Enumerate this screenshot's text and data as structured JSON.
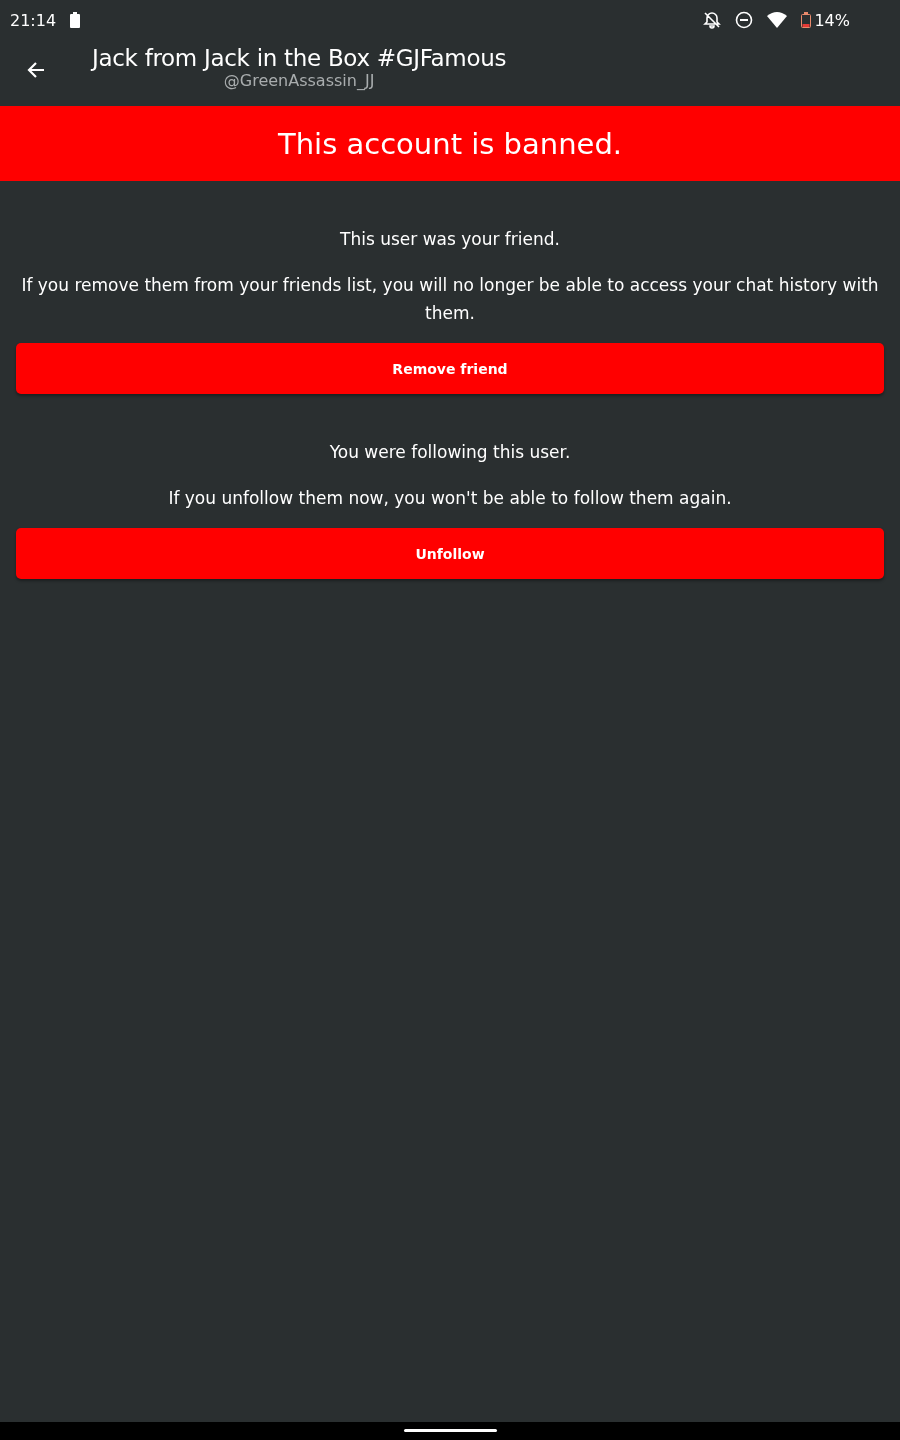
{
  "status_bar": {
    "time": "21:14",
    "battery": "14%"
  },
  "header": {
    "title": "Jack from Jack in the Box #GJFamous",
    "handle": "@GreenAssassin_JJ"
  },
  "banner": "This account is banned.",
  "sections": [
    {
      "heading": "This user was your friend.",
      "body": "If you remove them from your friends list, you will no longer be able to access your chat history with them.",
      "button": "Remove friend"
    },
    {
      "heading": "You were following this user.",
      "body": "If you unfollow them now, you won't be able to follow them again.",
      "button": "Unfollow"
    }
  ]
}
